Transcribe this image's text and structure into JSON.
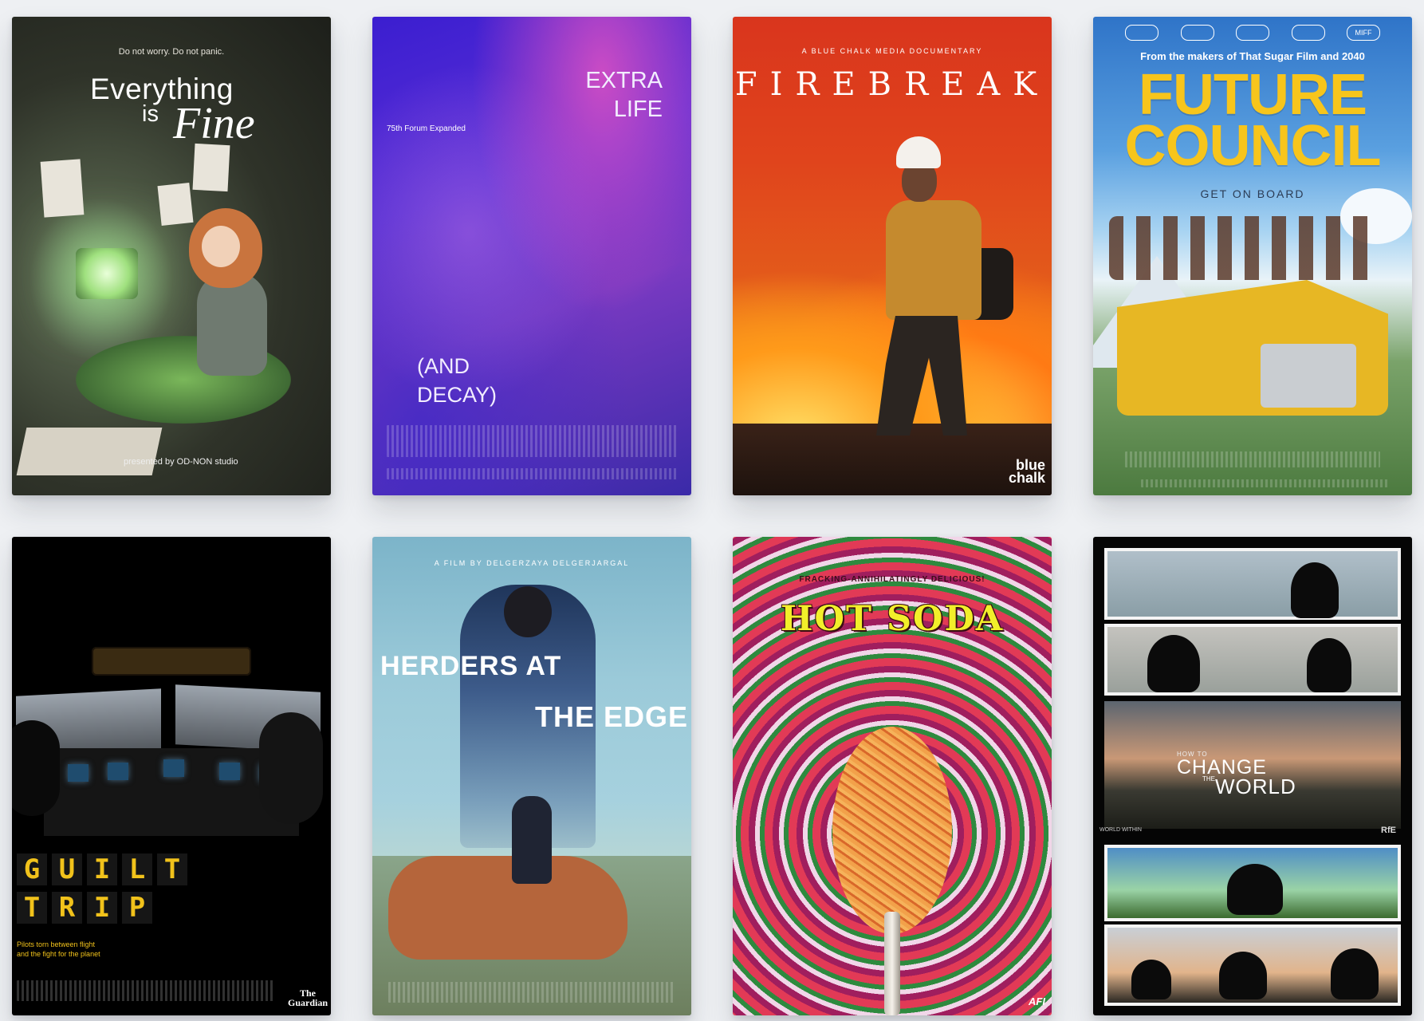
{
  "posters": [
    {
      "title": "Everything is Fine",
      "title_line1": "Everything",
      "title_is": "is",
      "title_fine": "Fine",
      "tagline": "Do not worry. Do not panic.",
      "presented_by": "presented by OD-NON studio"
    },
    {
      "title": "Extra Life (And Decay)",
      "title_line1": "EXTRA",
      "title_line2": "LIFE",
      "title_line3": "(AND",
      "title_line4": "DECAY)",
      "laurel": "75th Forum Expanded"
    },
    {
      "title": "Firebreak",
      "tagline": "A BLUE CHALK MEDIA DOCUMENTARY",
      "title_text": "FIREBREAK",
      "logo_line1": "blue",
      "logo_line2": "chalk"
    },
    {
      "title": "Future Council",
      "makers": "From the makers of That Sugar Film and 2040",
      "title_line1": "FUTURE",
      "title_line2": "COUNCIL",
      "tagline": "GET ON BOARD",
      "laurels": [
        "",
        "",
        "",
        "",
        "MIFF"
      ]
    },
    {
      "title": "Guilt Trip",
      "word1": [
        "G",
        "U",
        "I",
        "L",
        "T"
      ],
      "word2": [
        "T",
        "R",
        "I",
        "P"
      ],
      "subtitle_line1": "Pilots torn between flight",
      "subtitle_line2": "and the fight for the planet",
      "logo_line1": "The",
      "logo_line2": "Guardian"
    },
    {
      "title": "Herders at the Edge",
      "tagline": "A FILM BY DELGERZAYA DELGERJARGAL",
      "title_line1": "HERDERS AT",
      "title_line2": "THE EDGE"
    },
    {
      "title": "Hot Soda",
      "tagline": "FRACKING-ANNIHILATINGLY DELICIOUS!",
      "title_text": "HOT SODA",
      "logo": "AFI"
    },
    {
      "title": "How to Change the World",
      "how_to": "HOW TO",
      "word_change": "CHANGE",
      "word_the": "THE",
      "word_world": "WORLD",
      "label_left": "WORLD WITHIN",
      "label_right": "RfE"
    }
  ],
  "colors": {
    "page_background": "#eef0f3",
    "future_council_yellow": "#f7c51c",
    "guilt_trip_yellow": "#f1c21b",
    "hot_soda_yellow": "#f2ef2a"
  }
}
